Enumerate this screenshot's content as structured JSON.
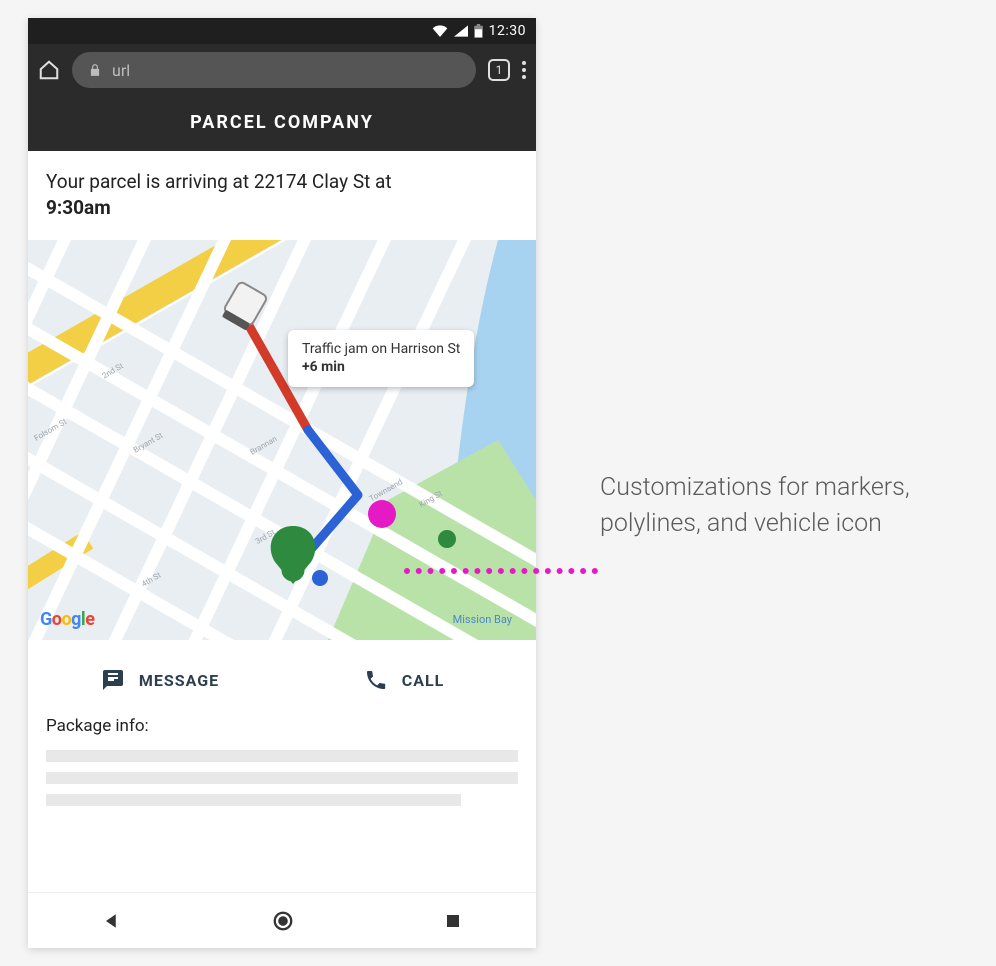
{
  "statusbar": {
    "time": "12:30"
  },
  "browser": {
    "url_text": "url",
    "tab_count": "1"
  },
  "company": {
    "name": "PARCEL COMPANY"
  },
  "arrival": {
    "prefix": "Your parcel is arriving at ",
    "address": "22174 Clay St",
    "connector": " at",
    "time": "9:30am"
  },
  "map": {
    "tooltip_line1": "Traffic jam on Harrison St",
    "tooltip_delay": "+6 min",
    "provider": "Google",
    "label_missionbay": "Mission Bay"
  },
  "actions": {
    "message_label": "MESSAGE",
    "call_label": "CALL"
  },
  "package": {
    "heading": "Package info:"
  },
  "annotation": {
    "text": "Customizations for markers, polylines, and vehicle icon"
  }
}
